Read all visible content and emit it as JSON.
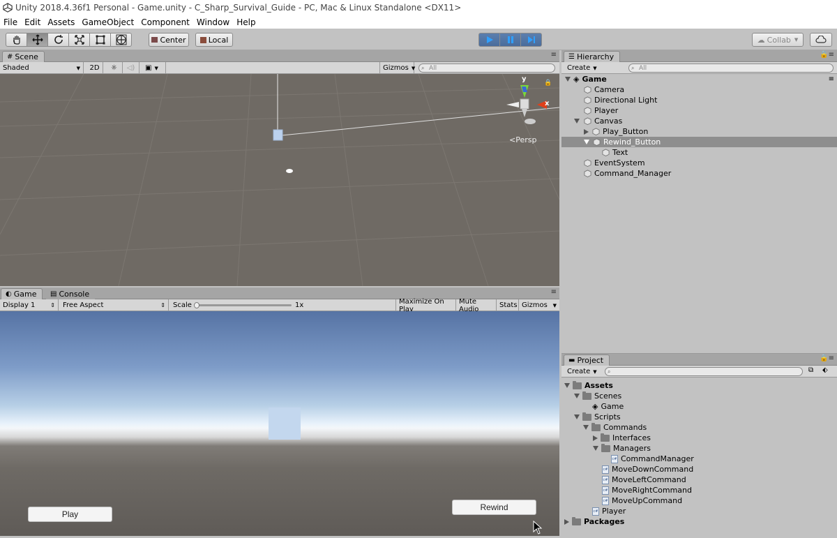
{
  "window": {
    "title": "Unity 2018.4.36f1 Personal - Game.unity - C_Sharp_Survival_Guide - PC, Mac & Linux Standalone <DX11>"
  },
  "menu": [
    "File",
    "Edit",
    "Assets",
    "GameObject",
    "Component",
    "Window",
    "Help"
  ],
  "toolbar": {
    "center_label": "Center",
    "local_label": "Local",
    "collab_label": "Collab"
  },
  "scene": {
    "tab_label": "Scene",
    "shading": "Shaded",
    "mode_2d": "2D",
    "gizmos": "Gizmos",
    "search_placeholder": "All",
    "persp_label": "Persp",
    "axis_y": "y",
    "axis_x": "x"
  },
  "game": {
    "tab_label": "Game",
    "console_tab_label": "Console",
    "display": "Display 1",
    "aspect": "Free Aspect",
    "scale_label": "Scale",
    "scale_value": "1x",
    "maximize": "Maximize On Play",
    "mute": "Mute Audio",
    "stats": "Stats",
    "gizmos": "Gizmos",
    "play_button": "Play",
    "rewind_button": "Rewind"
  },
  "hierarchy": {
    "tab_label": "Hierarchy",
    "create": "Create",
    "search_placeholder": "All",
    "scene_name": "Game",
    "items": [
      {
        "label": "Camera"
      },
      {
        "label": "Directional Light"
      },
      {
        "label": "Player"
      },
      {
        "label": "Canvas"
      },
      {
        "label": "Play_Button"
      },
      {
        "label": "Rewind_Button"
      },
      {
        "label": "Text"
      },
      {
        "label": "EventSystem"
      },
      {
        "label": "Command_Manager"
      }
    ]
  },
  "project": {
    "tab_label": "Project",
    "create": "Create",
    "items": [
      {
        "label": "Assets"
      },
      {
        "label": "Scenes"
      },
      {
        "label": "Game"
      },
      {
        "label": "Scripts"
      },
      {
        "label": "Commands"
      },
      {
        "label": "Interfaces"
      },
      {
        "label": "Managers"
      },
      {
        "label": "CommandManager"
      },
      {
        "label": "MoveDownCommand"
      },
      {
        "label": "MoveLeftCommand"
      },
      {
        "label": "MoveRightCommand"
      },
      {
        "label": "MoveUpCommand"
      },
      {
        "label": "Player"
      },
      {
        "label": "Packages"
      }
    ]
  }
}
